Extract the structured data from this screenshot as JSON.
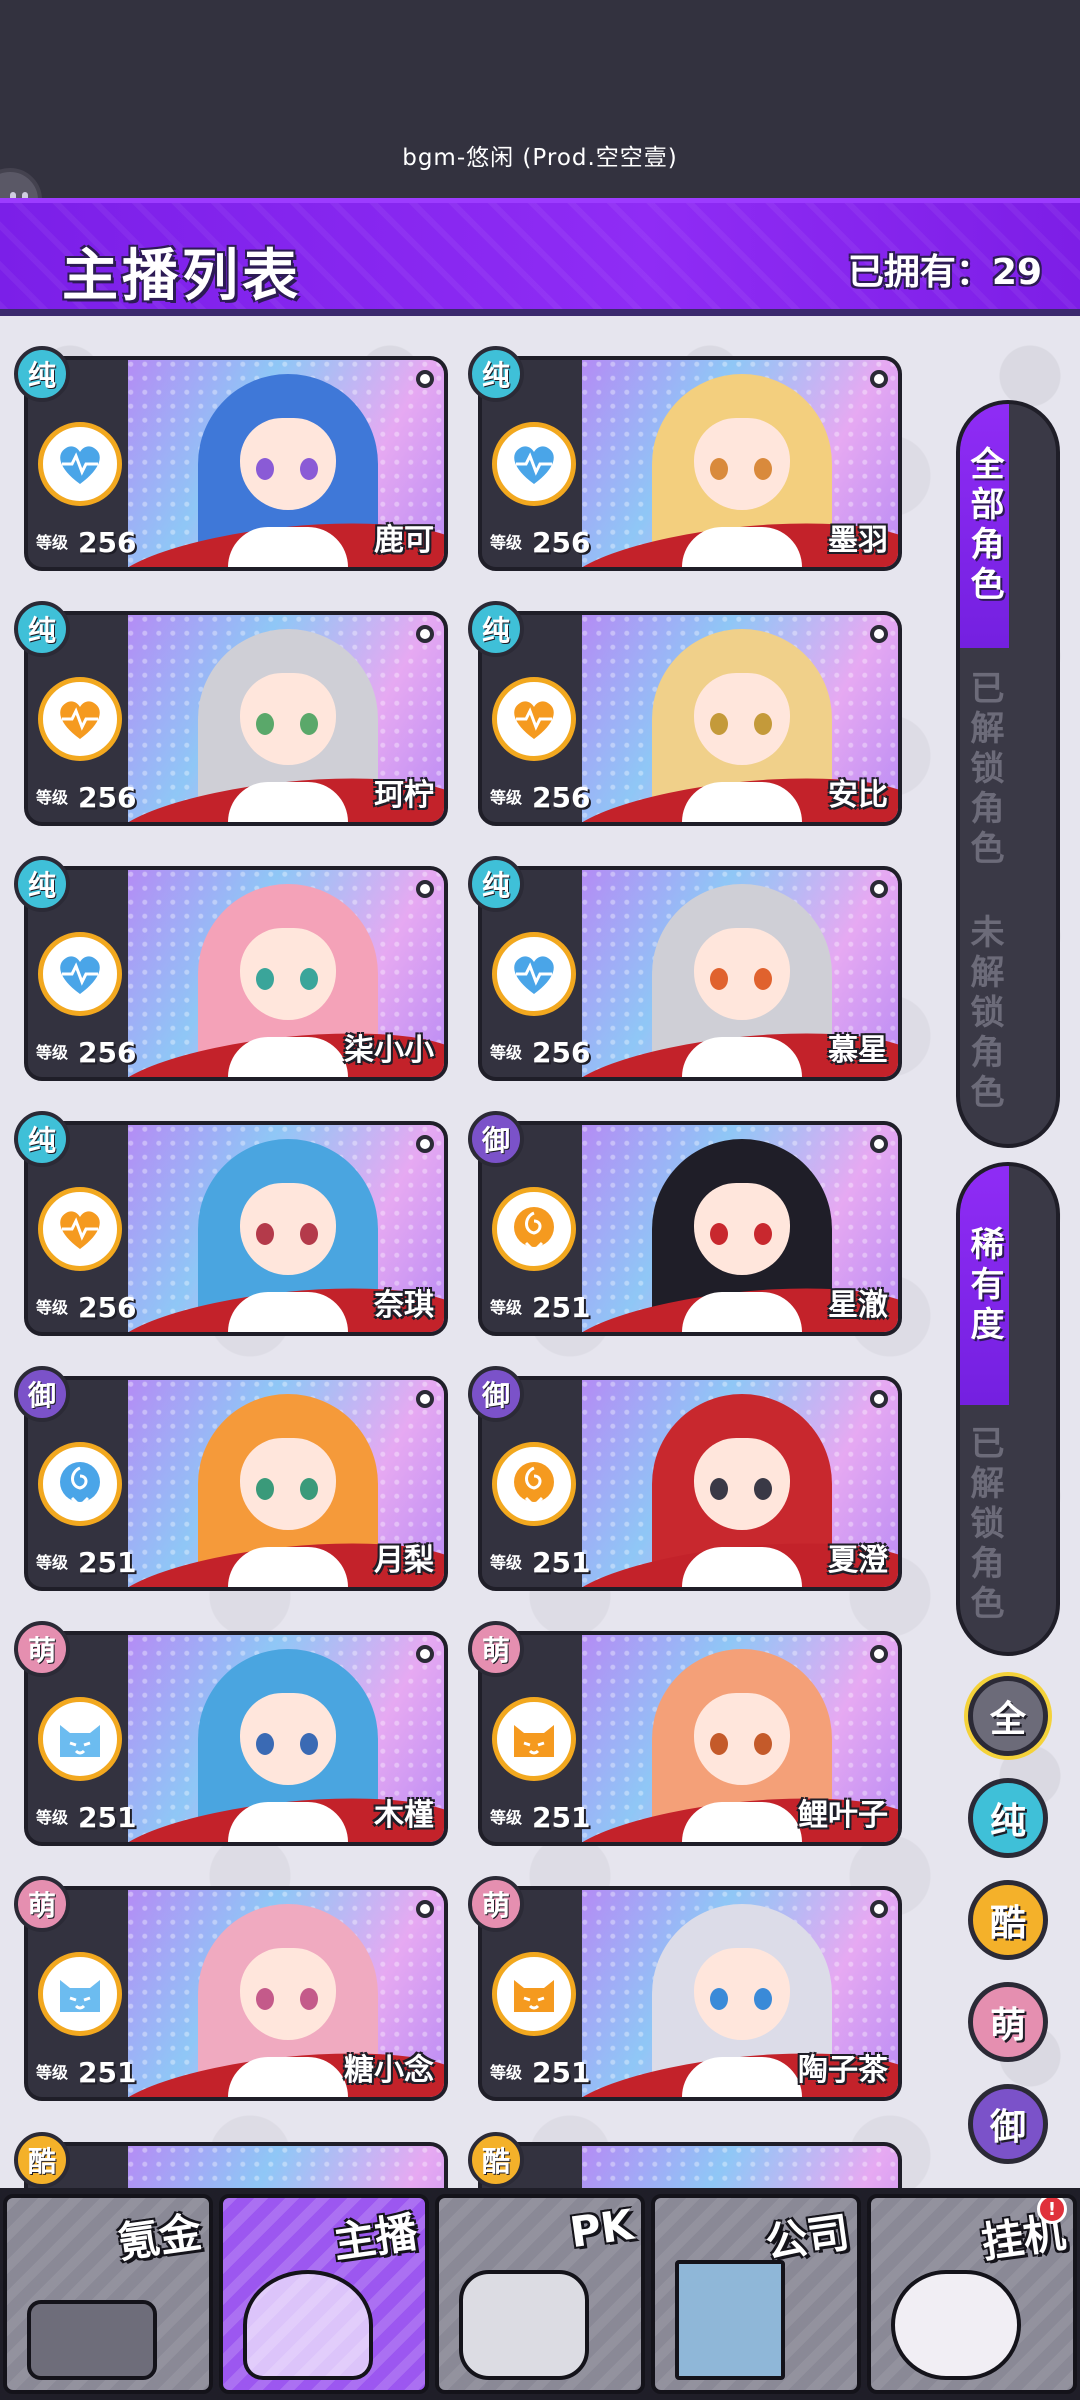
{
  "status": {
    "bgm": "bgm-悠闲 (Prod.空空壹)"
  },
  "header": {
    "title": "主播列表",
    "owned": "已拥有：29"
  },
  "streamers": [
    {
      "name": "鹿可",
      "rarity": "纯",
      "level": "256",
      "level_label": "等级",
      "rarity_color": "chun",
      "type": "heart",
      "hair": "#3f78d8",
      "eye": "#8a5bd6"
    },
    {
      "name": "墨羽",
      "rarity": "纯",
      "level": "256",
      "level_label": "等级",
      "rarity_color": "chun",
      "type": "heart",
      "hair": "#f3cf7e",
      "eye": "#d98a3c"
    },
    {
      "name": "珂柠",
      "rarity": "纯",
      "level": "256",
      "level_label": "等级",
      "rarity_color": "chun",
      "type": "heart-orange",
      "hair": "#cfcfd6",
      "eye": "#5aa86a"
    },
    {
      "name": "安比",
      "rarity": "纯",
      "level": "256",
      "level_label": "等级",
      "rarity_color": "chun",
      "type": "heart-orange",
      "hair": "#f0d08a",
      "eye": "#c49a3a"
    },
    {
      "name": "柒小小",
      "rarity": "纯",
      "level": "256",
      "level_label": "等级",
      "rarity_color": "chun",
      "type": "heart",
      "hair": "#f4a2b8",
      "eye": "#3aa59a"
    },
    {
      "name": "慕星",
      "rarity": "纯",
      "level": "256",
      "level_label": "等级",
      "rarity_color": "chun",
      "type": "heart",
      "hair": "#cfcfd6",
      "eye": "#e0622e"
    },
    {
      "name": "奈琪",
      "rarity": "纯",
      "level": "256",
      "level_label": "等级",
      "rarity_color": "chun",
      "type": "heart-orange",
      "hair": "#4aa5e0",
      "eye": "#b43a4a"
    },
    {
      "name": "星澈",
      "rarity": "御",
      "level": "251",
      "level_label": "等级",
      "rarity_color": "yu",
      "type": "rose-orange",
      "hair": "#1f1e28",
      "eye": "#c8282e"
    },
    {
      "name": "月梨",
      "rarity": "御",
      "level": "251",
      "level_label": "等级",
      "rarity_color": "yu",
      "type": "rose",
      "hair": "#f59a3a",
      "eye": "#3a9a7a"
    },
    {
      "name": "夏澄",
      "rarity": "御",
      "level": "251",
      "level_label": "等级",
      "rarity_color": "yu",
      "type": "rose-orange",
      "hair": "#c8282e",
      "eye": "#3a3946"
    },
    {
      "name": "木槿",
      "rarity": "萌",
      "level": "251",
      "level_label": "等级",
      "rarity_color": "meng",
      "type": "cat",
      "hair": "#4aa5e0",
      "eye": "#3a6ab4"
    },
    {
      "name": "鲤叶子",
      "rarity": "萌",
      "level": "251",
      "level_label": "等级",
      "rarity_color": "meng",
      "type": "cat-orange",
      "hair": "#f4a078",
      "eye": "#c45a2a"
    },
    {
      "name": "糖小念",
      "rarity": "萌",
      "level": "251",
      "level_label": "等级",
      "rarity_color": "meng",
      "type": "cat",
      "hair": "#f0aac0",
      "eye": "#c45a8a"
    },
    {
      "name": "陶子茶",
      "rarity": "萌",
      "level": "251",
      "level_label": "等级",
      "rarity_color": "meng",
      "type": "cat-orange",
      "hair": "#dcdce8",
      "eye": "#3a8ad8"
    }
  ],
  "partial_row": [
    {
      "rarity": "酷"
    },
    {
      "rarity": "酷"
    }
  ],
  "filters": {
    "role_group": [
      {
        "label": "全部角色",
        "active": true
      },
      {
        "label": "已解锁角色",
        "active": false
      },
      {
        "label": "未解锁角色",
        "active": false
      }
    ],
    "rarity_group": [
      {
        "label": "稀有度",
        "active": true
      },
      {
        "label": "已解锁角色",
        "active": false
      }
    ],
    "rarity_buttons": [
      {
        "label": "全",
        "color": "#6c6b79"
      },
      {
        "label": "纯",
        "color": "#3fc0d8"
      },
      {
        "label": "酷",
        "color": "#f4b12a"
      },
      {
        "label": "萌",
        "color": "#e58fb0"
      },
      {
        "label": "御",
        "color": "#7b52c9"
      }
    ]
  },
  "bottom_nav": [
    {
      "label": "氪金",
      "active": false,
      "art": "coins"
    },
    {
      "label": "主播",
      "active": true,
      "art": "pig-head"
    },
    {
      "label": "PK",
      "active": false,
      "art": "pk"
    },
    {
      "label": "公司",
      "active": false,
      "art": "bld"
    },
    {
      "label": "挂机",
      "active": false,
      "art": "pig",
      "badge": "!"
    }
  ],
  "colors": {
    "accent_purple": "#8f2cf5",
    "card_red": "#c3222a",
    "rarity_chun": "#3fc0d8",
    "rarity_yu": "#7b52c9",
    "rarity_meng": "#e58fb0",
    "rarity_ku": "#f4b12a"
  }
}
